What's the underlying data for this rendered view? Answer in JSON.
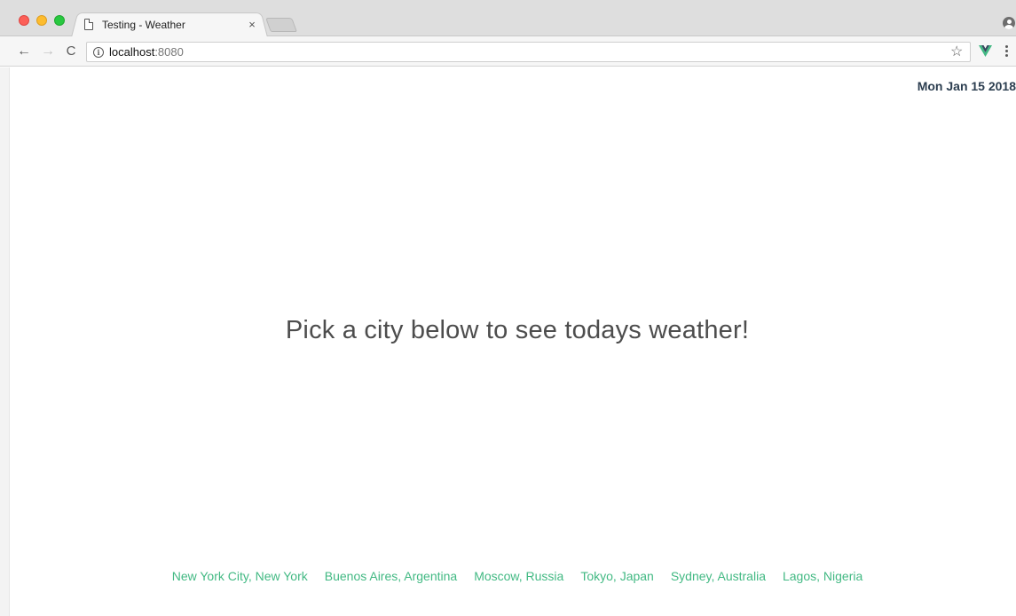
{
  "browser": {
    "tab": {
      "title": "Testing - Weather",
      "close": "×"
    },
    "address": {
      "host": "localhost",
      "port": ":8080"
    },
    "icons": {
      "back": "←",
      "forward": "→",
      "reload": "C",
      "info": "i",
      "star": "☆"
    },
    "colors": {
      "vue_green": "#42b883",
      "vue_dark": "#35495e"
    }
  },
  "page": {
    "date": "Mon Jan 15 2018",
    "headline": "Pick a city below to see todays weather!",
    "cities": [
      "New York City, New York",
      "Buenos Aires, Argentina",
      "Moscow, Russia",
      "Tokyo, Japan",
      "Sydney, Australia",
      "Lagos, Nigeria"
    ],
    "colors": {
      "link": "#42b983",
      "date": "#2c3e50",
      "headline": "#4d4d4d"
    }
  }
}
